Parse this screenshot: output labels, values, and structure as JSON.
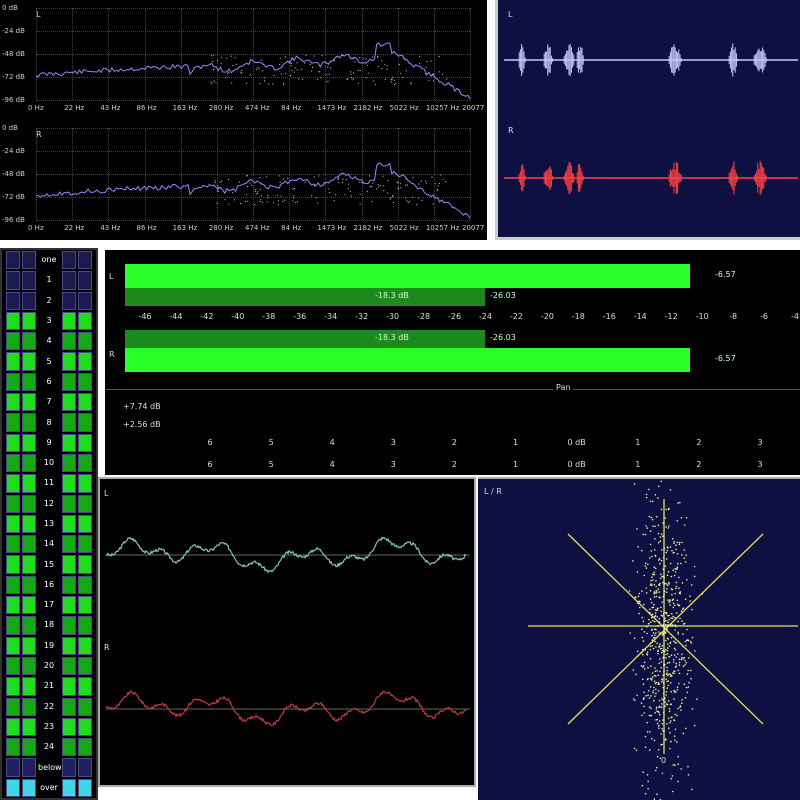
{
  "spectrum": {
    "channels": [
      "L",
      "R"
    ],
    "db_labels": [
      "0 dB",
      "-24 dB",
      "-48 dB",
      "-72 dB",
      "-96 dB"
    ],
    "freq_labels": [
      "0 Hz",
      "22 Hz",
      "43 Hz",
      "86 Hz",
      "163 Hz",
      "280 Hz",
      "474 Hz",
      "84 Hz",
      "1473 Hz",
      "2182 Hz",
      "5022 Hz",
      "10257 Hz",
      "20077 Hz"
    ]
  },
  "waveform": {
    "channels": [
      "L",
      "R"
    ],
    "colors": {
      "L": "#c8c8ff",
      "R": "#ff4040"
    }
  },
  "channel_meter": {
    "rows": [
      "one",
      "1",
      "2",
      "3",
      "4",
      "5",
      "6",
      "7",
      "8",
      "9",
      "10",
      "11",
      "12",
      "13",
      "14",
      "15",
      "16",
      "17",
      "18",
      "19",
      "20",
      "21",
      "22",
      "23",
      "24",
      "below",
      "over"
    ]
  },
  "level_meter": {
    "channels": [
      "L",
      "R"
    ],
    "peak_value": "-6.57",
    "rms_label": "-18.3 dB",
    "rms_value": "-26.03",
    "scale": [
      "-46",
      "-44",
      "-42",
      "-40",
      "-38",
      "-36",
      "-34",
      "-32",
      "-30",
      "-28",
      "-26",
      "-24",
      "-22",
      "-20",
      "-18",
      "-16",
      "-14",
      "-12",
      "-10",
      "-8",
      "-6",
      "-4"
    ],
    "colors": {
      "bright": "#2bff2b",
      "dim": "#1e8a1e"
    }
  },
  "pan": {
    "label": "Pan",
    "left_db": "+7.74 dB",
    "right_db": "+2.56 dB",
    "ticks": [
      "6",
      "5",
      "4",
      "3",
      "2",
      "1",
      "0 dB",
      "1",
      "2",
      "3"
    ]
  },
  "oscilloscope": {
    "channels": [
      "L",
      "R"
    ],
    "colors": {
      "L": "#7fc9b0",
      "R": "#c03a3a"
    }
  },
  "vectorscope": {
    "label": "L / R",
    "zero": "0",
    "color": "#e8e060"
  }
}
